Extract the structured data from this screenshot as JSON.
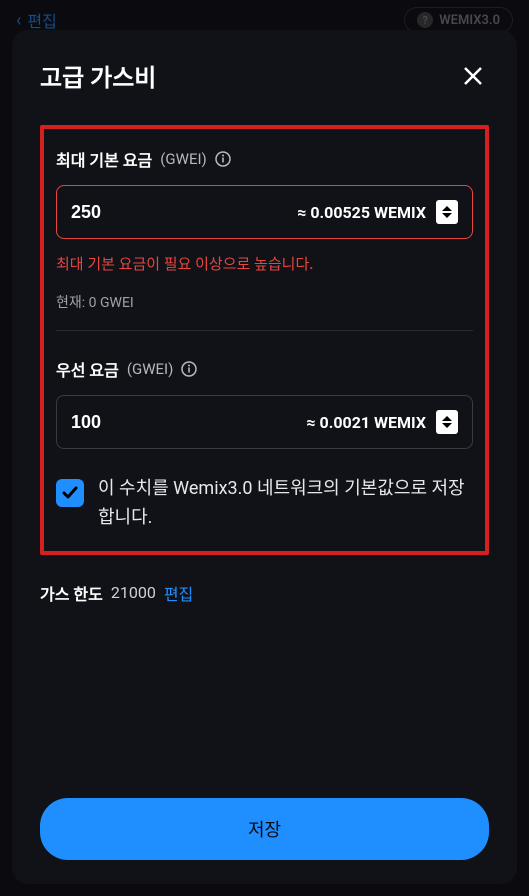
{
  "background": {
    "back_label": "편집",
    "network_label": "WEMIX3.0"
  },
  "modal": {
    "title": "고급 가스비"
  },
  "max_base_fee": {
    "label": "최대 기본 요금",
    "unit": "(GWEI)",
    "value": "250",
    "approx": "≈ 0.00525 WEMIX",
    "error": "최대 기본 요금이 필요 이상으로 높습니다.",
    "current_label": "현재:",
    "current_value": "0 GWEI"
  },
  "priority_fee": {
    "label": "우선 요금",
    "unit": "(GWEI)",
    "value": "100",
    "approx": "≈ 0.0021 WEMIX"
  },
  "save_default": {
    "label": "이 수치를 Wemix3.0 네트워크의 기본값으로 저장합니다."
  },
  "gas_limit": {
    "label": "가스 한도",
    "value": "21000",
    "edit": "편집"
  },
  "actions": {
    "save": "저장"
  }
}
